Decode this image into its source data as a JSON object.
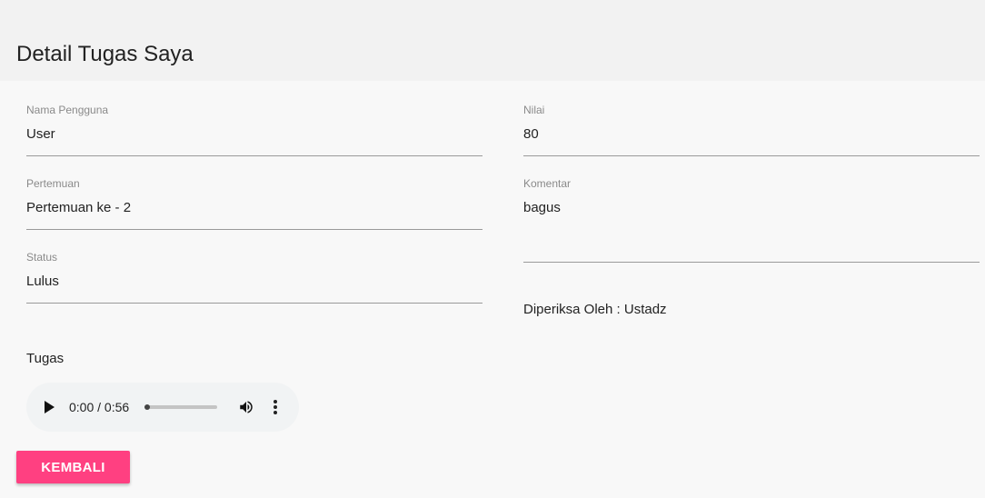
{
  "header": {
    "title": "Detail Tugas Saya"
  },
  "form": {
    "nama_pengguna": {
      "label": "Nama Pengguna",
      "value": "User"
    },
    "pertemuan": {
      "label": "Pertemuan",
      "value": "Pertemuan ke - 2"
    },
    "status": {
      "label": "Status",
      "value": "Lulus"
    },
    "nilai": {
      "label": "Nilai",
      "value": "80"
    },
    "komentar": {
      "label": "Komentar",
      "value": "bagus"
    },
    "diperiksa_oleh": "Diperiksa Oleh : Ustadz"
  },
  "tugas": {
    "label": "Tugas",
    "audio": {
      "time": "0:00 / 0:56",
      "progress": 0,
      "icons": [
        "play-icon",
        "volume-icon",
        "more-vert-icon"
      ]
    }
  },
  "actions": {
    "back_label": "KEMBALI"
  },
  "colors": {
    "accent": "#ff4081",
    "header_bg": "#f2f2f2",
    "page_bg": "#f8f8f8"
  }
}
